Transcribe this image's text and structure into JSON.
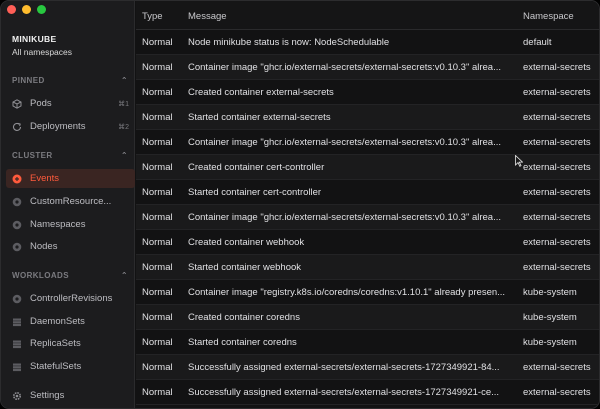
{
  "window": {
    "traffic_lights": [
      "close",
      "minimize",
      "zoom"
    ],
    "colors": {
      "close": "#ff5f57",
      "minimize": "#febc2e",
      "zoom": "#28c840",
      "accent": "#ff5a3c"
    }
  },
  "sidebar": {
    "cluster_name": "MINIKUBE",
    "namespace_scope": "All namespaces",
    "sections": [
      {
        "title": "PINNED",
        "items": [
          {
            "label": "Pods",
            "shortcut": "⌘1",
            "icon": "cube-icon"
          },
          {
            "label": "Deployments",
            "shortcut": "⌘2",
            "icon": "refresh-icon"
          }
        ]
      },
      {
        "title": "CLUSTER",
        "items": [
          {
            "label": "Events",
            "icon": "events-icon",
            "active": true
          },
          {
            "label": "CustomResource...",
            "icon": "circle-icon"
          },
          {
            "label": "Namespaces",
            "icon": "circle-icon"
          },
          {
            "label": "Nodes",
            "icon": "circle-icon"
          }
        ]
      },
      {
        "title": "WORKLOADS",
        "items": [
          {
            "label": "ControllerRevisions",
            "icon": "circle-icon"
          },
          {
            "label": "DaemonSets",
            "icon": "stack-icon"
          },
          {
            "label": "ReplicaSets",
            "icon": "stack-icon"
          },
          {
            "label": "StatefulSets",
            "icon": "stack-icon"
          }
        ]
      }
    ],
    "settings_label": "Settings"
  },
  "table": {
    "columns": [
      "Type",
      "Message",
      "Namespace"
    ],
    "rows": [
      {
        "type": "Normal",
        "message": "Node minikube status is now: NodeSchedulable",
        "namespace": "default"
      },
      {
        "type": "Normal",
        "message": "Container image \"ghcr.io/external-secrets/external-secrets:v0.10.3\" alrea...",
        "namespace": "external-secrets"
      },
      {
        "type": "Normal",
        "message": "Created container external-secrets",
        "namespace": "external-secrets"
      },
      {
        "type": "Normal",
        "message": "Started container external-secrets",
        "namespace": "external-secrets"
      },
      {
        "type": "Normal",
        "message": "Container image \"ghcr.io/external-secrets/external-secrets:v0.10.3\" alrea...",
        "namespace": "external-secrets"
      },
      {
        "type": "Normal",
        "message": "Created container cert-controller",
        "namespace": "external-secrets"
      },
      {
        "type": "Normal",
        "message": "Started container cert-controller",
        "namespace": "external-secrets"
      },
      {
        "type": "Normal",
        "message": "Container image \"ghcr.io/external-secrets/external-secrets:v0.10.3\" alrea...",
        "namespace": "external-secrets"
      },
      {
        "type": "Normal",
        "message": "Created container webhook",
        "namespace": "external-secrets"
      },
      {
        "type": "Normal",
        "message": "Started container webhook",
        "namespace": "external-secrets"
      },
      {
        "type": "Normal",
        "message": "Container image \"registry.k8s.io/coredns/coredns:v1.10.1\" already presen...",
        "namespace": "kube-system"
      },
      {
        "type": "Normal",
        "message": "Created container coredns",
        "namespace": "kube-system"
      },
      {
        "type": "Normal",
        "message": "Started container coredns",
        "namespace": "kube-system"
      },
      {
        "type": "Normal",
        "message": "Successfully assigned external-secrets/external-secrets-1727349921-84...",
        "namespace": "external-secrets"
      },
      {
        "type": "Normal",
        "message": "Successfully assigned external-secrets/external-secrets-1727349921-ce...",
        "namespace": "external-secrets"
      }
    ]
  }
}
